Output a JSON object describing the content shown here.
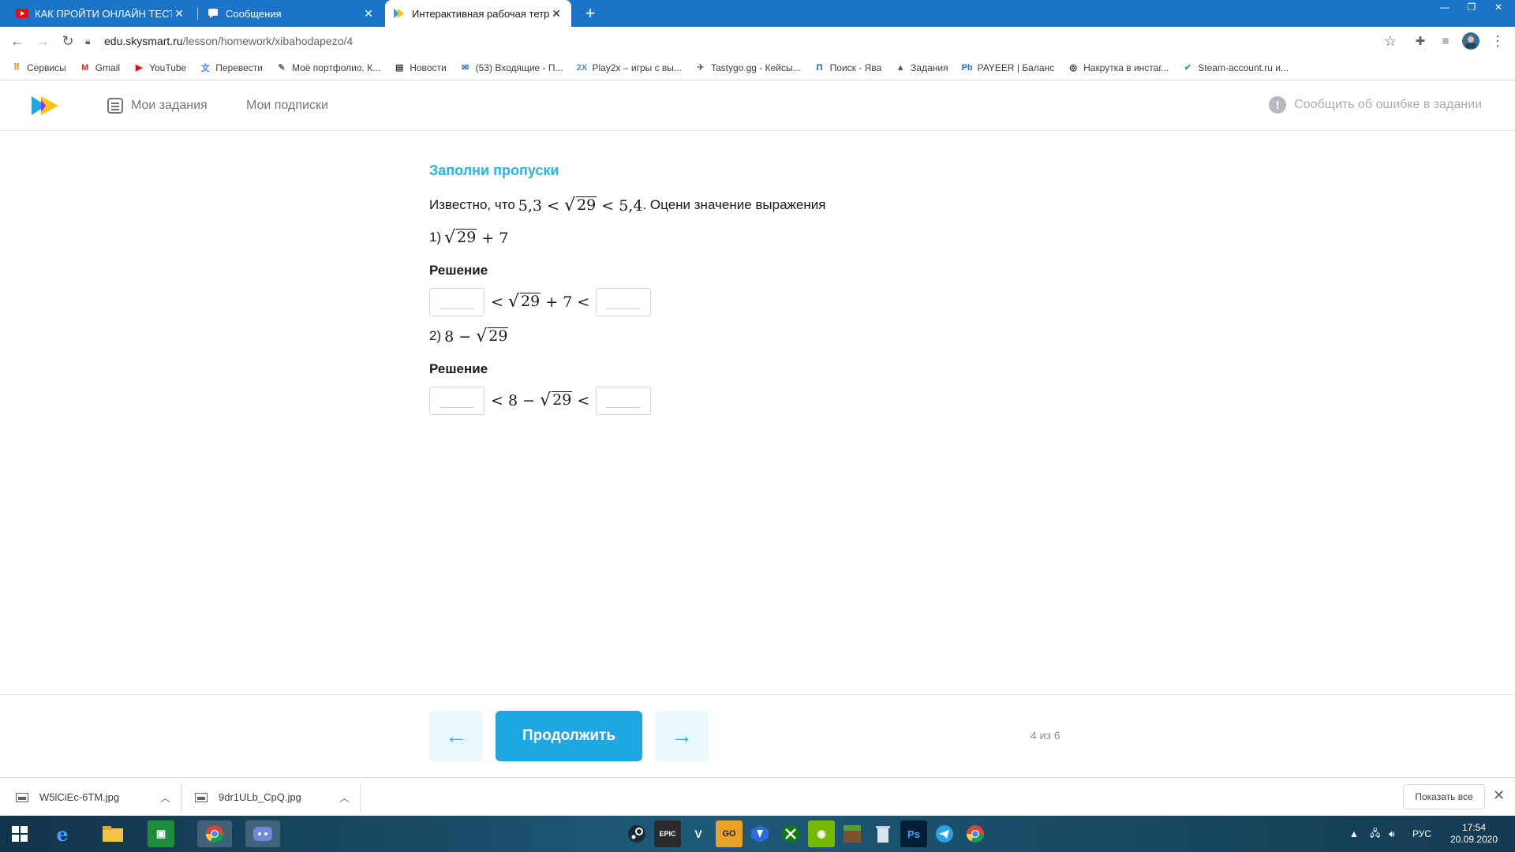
{
  "browser": {
    "tabs": [
      {
        "title": "КАК ПРОЙТИ ОНЛАЙН ТЕСТ НА",
        "icon": "youtube-icon",
        "active": false
      },
      {
        "title": "Сообщения",
        "icon": "chat-icon",
        "active": false
      },
      {
        "title": "Интерактивная рабочая тетрад",
        "icon": "skysmart-icon",
        "active": true
      }
    ],
    "new_tab_label": "+",
    "url_host": "edu.skysmart.ru",
    "url_path": "/lesson/homework/xibahodapezo/4",
    "bookmarks": [
      {
        "label": "Сервисы",
        "icon": "apps-grid-icon",
        "color": "#e8710a"
      },
      {
        "label": "Gmail",
        "icon": "gmail-icon",
        "color": "#d93025"
      },
      {
        "label": "YouTube",
        "icon": "youtube-icon",
        "color": "#ff0000"
      },
      {
        "label": "Перевести",
        "icon": "translate-icon",
        "color": "#4285f4"
      },
      {
        "label": "Моё портфолио. К...",
        "icon": "portfolio-icon",
        "color": "#5f6368"
      },
      {
        "label": "Новости",
        "icon": "news-icon",
        "color": "#3c4043"
      },
      {
        "label": "(53) Входящие - П...",
        "icon": "mail-icon",
        "color": "#1a73e8"
      },
      {
        "label": "Play2x – игры с вы...",
        "icon": "play2x-icon",
        "color": "#4a90d9"
      },
      {
        "label": "Tastygo.gg - Кейсы...",
        "icon": "tastygo-icon",
        "color": "#5f6368"
      },
      {
        "label": "Поиск - Ява",
        "icon": "yava-icon",
        "color": "#1a5fb4"
      },
      {
        "label": "Задания",
        "icon": "tasks-icon",
        "color": "#3d4b9e"
      },
      {
        "label": "PAYEER | Баланс",
        "icon": "payeer-icon",
        "color": "#1a73e8"
      },
      {
        "label": "Накрутка в инстаг...",
        "icon": "instagram-icon",
        "color": "#202124"
      },
      {
        "label": "Steam-account.ru и...",
        "icon": "checkmark-icon",
        "color": "#34a853"
      }
    ]
  },
  "site": {
    "nav": {
      "my_tasks": "Мои задания",
      "my_subscriptions": "Мои подписки"
    },
    "report_error": "Сообщить об ошибке в задании"
  },
  "task": {
    "title": "Заполни пропуски",
    "intro_prefix": "Известно, что",
    "bound_low": "5,3",
    "lt": "<",
    "radicand": "29",
    "bound_high": "5,4",
    "intro_suffix": ". Оцени значение выражения",
    "part1_label": "1)",
    "part1_plus": "+ 7",
    "part2_label": "2)",
    "part2_minus": "8 −",
    "solution_label": "Решение"
  },
  "footer": {
    "prev_label": "←",
    "continue_label": "Продолжить",
    "next_label": "→",
    "progress": "4 из 6"
  },
  "downloads": {
    "items": [
      "W5lCiEc-6TM.jpg",
      "9dr1ULb_CpQ.jpg"
    ],
    "show_all": "Показать все"
  },
  "taskbar": {
    "lang": "РУС",
    "time": "17:54",
    "date": "20.09.2020"
  }
}
